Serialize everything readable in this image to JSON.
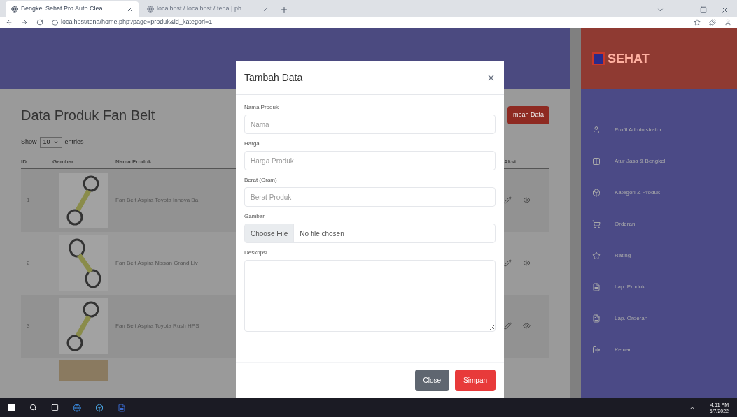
{
  "browser": {
    "tabs": [
      {
        "title": "Bengkel Sehat Pro Auto Clea",
        "selected": true
      },
      {
        "title": "localhost / localhost / tena | ph",
        "selected": false
      }
    ],
    "address": "localhost/tena/home.php?page=produk&id_kategori=1"
  },
  "header": {
    "title": "Data Produk Fan Belt",
    "add_button": "mbah Data"
  },
  "table": {
    "length_label": "Show",
    "length_value": "10",
    "length_suffix": "entries",
    "columns": [
      "ID",
      "Gambar",
      "Nama Produk",
      "Aksi"
    ],
    "rows": [
      {
        "id": "1",
        "name": "Fan Belt Aspira Toyota Innova Ba"
      },
      {
        "id": "2",
        "name": "Fan Belt Aspira Nissan Grand Liv"
      },
      {
        "id": "3",
        "name": "Fan Belt Aspira Toyota Rush HPS"
      }
    ]
  },
  "sidebar": {
    "logo": "SEHAT",
    "items": [
      {
        "label": "Profil Administrator"
      },
      {
        "label": "Atur Jasa & Bengkel"
      },
      {
        "label": "Kategori & Produk"
      },
      {
        "label": "Orderan"
      },
      {
        "label": "Rating"
      },
      {
        "label": "Lap. Produk"
      },
      {
        "label": "Lap. Orderan"
      },
      {
        "label": "Keluar"
      }
    ]
  },
  "modal": {
    "title": "Tambah Data",
    "fields": [
      {
        "kind": "text",
        "label": "Nama Produk",
        "placeholder": "Nama"
      },
      {
        "kind": "text",
        "label": "Harga",
        "placeholder": "Harga Produk"
      },
      {
        "kind": "text",
        "label": "Berat (Gram)",
        "placeholder": "Berat Produk"
      },
      {
        "kind": "file",
        "label": "Gambar",
        "button": "Choose File",
        "value": "No file chosen"
      },
      {
        "kind": "textarea",
        "label": "Deskripsi"
      }
    ],
    "close": "Close",
    "save": "Simpan"
  },
  "taskbar": {
    "time": "4:51 PM",
    "date": "5/7/2022"
  }
}
